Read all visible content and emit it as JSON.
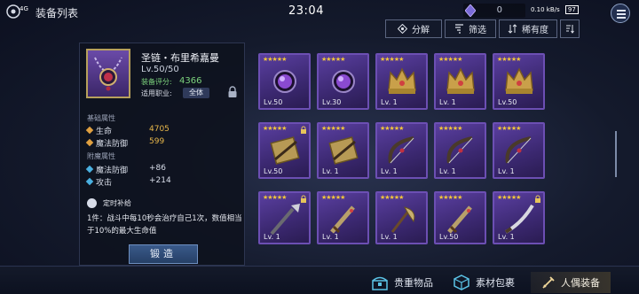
{
  "status": {
    "signal": "4G",
    "title": "装备列表",
    "time": "23:04",
    "currency_value": "0",
    "battery": "97",
    "net": "0.10 kB/s"
  },
  "toolbar": {
    "decompose": "分解",
    "filter": "筛选",
    "rarity": "稀有度"
  },
  "detail": {
    "name": "圣链・布里希嘉曼",
    "level": "Lv.50/50",
    "score_label": "装备评分:",
    "score": "4366",
    "job_label": "适用职业:",
    "job": "全体",
    "base_title": "基础属性",
    "base_stats": [
      {
        "name": "生命",
        "value": "4705"
      },
      {
        "name": "魔法防御",
        "value": "599"
      }
    ],
    "extra_title": "附魔属性",
    "extra_stats": [
      {
        "name": "魔法防御",
        "value": "+86"
      },
      {
        "name": "攻击",
        "value": "+214"
      }
    ],
    "skill_name": "定时补给",
    "skill_desc": "1件：战斗中每10秒会治疗自己1次，数值相当于10%的最大生命值",
    "forge": "锻造"
  },
  "items": [
    {
      "stars": "★★★★★",
      "level": "Lv.50",
      "icon": "dark-orb-icon",
      "locked": false
    },
    {
      "stars": "★★★★★",
      "level": "Lv.30",
      "icon": "dark-orb-icon",
      "locked": false
    },
    {
      "stars": "★★★★★",
      "level": "Lv. 1",
      "icon": "golden-crown-icon",
      "locked": false
    },
    {
      "stars": "★★★★★",
      "level": "Lv. 1",
      "icon": "golden-crown-icon",
      "locked": false
    },
    {
      "stars": "★★★★★",
      "level": "Lv.50",
      "icon": "golden-crown-icon",
      "locked": false
    },
    {
      "stars": "★★★★★",
      "level": "Lv.50",
      "icon": "crossbow-icon",
      "locked": true
    },
    {
      "stars": "★★★★★",
      "level": "Lv. 1",
      "icon": "crossbow-icon",
      "locked": false
    },
    {
      "stars": "★★★★★",
      "level": "Lv. 1",
      "icon": "bow-icon",
      "locked": false
    },
    {
      "stars": "★★★★★",
      "level": "Lv. 1",
      "icon": "bow-icon",
      "locked": false
    },
    {
      "stars": "★★★★★",
      "level": "Lv. 1",
      "icon": "bow-icon",
      "locked": false
    },
    {
      "stars": "★★★★★",
      "level": "Lv. 1",
      "icon": "spear-icon",
      "locked": true
    },
    {
      "stars": "★★★★★",
      "level": "Lv. 1",
      "icon": "sword-icon",
      "locked": false
    },
    {
      "stars": "★★★★★",
      "level": "Lv. 1",
      "icon": "axe-icon",
      "locked": false
    },
    {
      "stars": "★★★★★",
      "level": "Lv.50",
      "icon": "sword-icon",
      "locked": false
    },
    {
      "stars": "★★★★★",
      "level": "Lv. 1",
      "icon": "blade-icon",
      "locked": true
    }
  ],
  "tabs": {
    "valuables": "贵重物品",
    "materials": "素材包裹",
    "doll_equipment": "人偶装备"
  },
  "colors": {
    "card_border": "#6c4fb3",
    "star": "#f2c63c",
    "score_green": "#7cd27c",
    "hp_dot": "#e0a040",
    "mdef_dot": "#e0a040",
    "extra_dot": "#4ab0e0"
  }
}
